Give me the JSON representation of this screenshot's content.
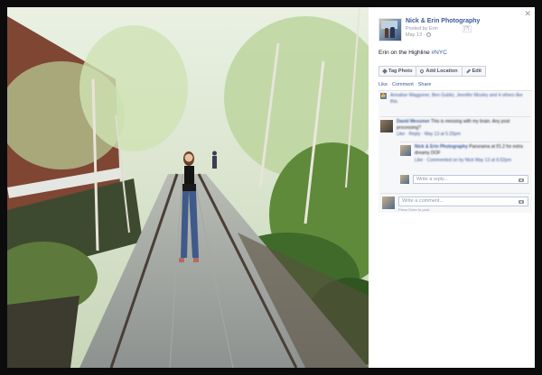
{
  "post": {
    "page_name": "Nick & Erin Photography",
    "posted_by_prefix": "Posted by ",
    "posted_by": "Erin",
    "badge": "[?]",
    "date": "May 13 ·",
    "caption_text": "Erin on the Highline ",
    "hashtag": "#NYC"
  },
  "actions": {
    "tag_photo": "Tag Photo",
    "add_location": "Add Location",
    "edit": "Edit"
  },
  "ufi": {
    "like": "Like",
    "dot1": " · ",
    "comment": "Comment",
    "dot2": " · ",
    "share": "Share",
    "likes_text": "Annalise Waggoner, Ben Gubitz, Jennifer Mosley and 4 others like this.",
    "comment1_author": "David Messmer",
    "comment1_text": " This is messing with my brain. Any post processing?",
    "comment1_meta": "Like · Reply · May 13 at 5:20pm",
    "reply_author": "Nick & Erin Photography",
    "reply_text": " Panorama at f/1.2 for extra dreamy DOF",
    "reply_meta": "Like · Commented on by Nick May 13 at 6:02pm",
    "reply_placeholder": "Write a reply...",
    "comment_placeholder": "Write a comment...",
    "enter_hint": "Press Enter to post."
  },
  "colors": {
    "link_blue": "#3b5998",
    "backdrop": "#0c0c0c",
    "panel_bg": "#ffffff",
    "ufi_bg": "#f6f7f9"
  },
  "icons": [
    "close-icon",
    "globe-icon",
    "tag-icon",
    "location-pin-icon",
    "pencil-icon",
    "thumbs-up-icon",
    "camera-icon"
  ]
}
